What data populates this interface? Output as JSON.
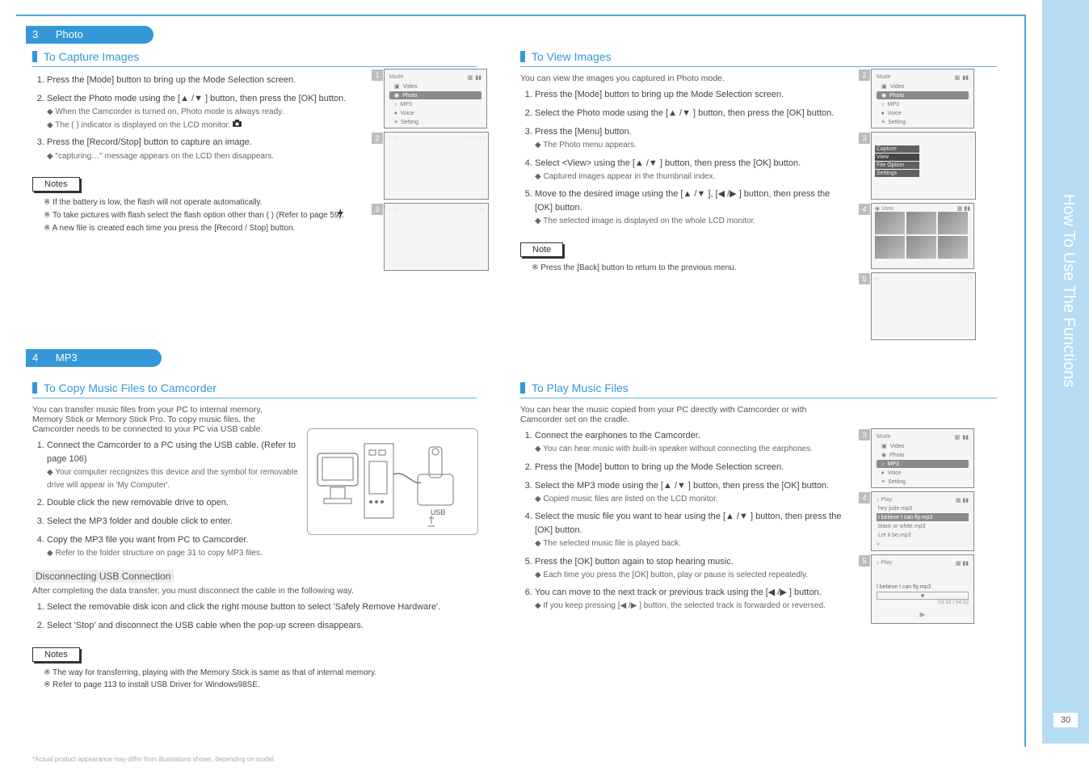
{
  "page": {
    "side_label": "How To Use The Functions",
    "page_number": "30"
  },
  "chapter_photo": {
    "tab_num": "3",
    "tab_title": "Photo"
  },
  "chapter_mp3": {
    "tab_num": "4",
    "tab_title": "MP3"
  },
  "sections": {
    "capture": {
      "title": "To Capture Images",
      "steps": [
        "Press the [Mode] button to bring up the Mode Selection screen.",
        "Select the Photo mode using the [▲ /▼ ] button, then press the [OK] button.",
        "◆ When the Camcorder is turned on, Photo mode is always ready.",
        "◆ The ( ) indicator is displayed on the LCD monitor.",
        "Press the [Record/Stop] button to capture an image.",
        "◆ \"capturing…\" message appears on the LCD then disappears."
      ],
      "notes_label": "Notes",
      "notes": [
        "If the battery is low, the flash will not operate automatically.",
        "To take pictures with flash select the flash option other than ( ) (Refer to page 59).",
        "A new file is created each time you press the [Record / Stop] button."
      ]
    },
    "view": {
      "title": "To View Images",
      "intro": "You can view the images you captured in Photo mode.",
      "steps": [
        "Press the [Mode] button to bring up the Mode Selection screen.",
        "Select the Photo mode using the [▲ /▼ ] button, then press the [OK] button.",
        "Press the [Menu] button.",
        "◆ The Photo menu appears.",
        "Select <View> using the [▲ /▼ ] button, then press the [OK] button.",
        "◆ Captured images appear in the thumbnail index.",
        "Move to the desired image using the [▲ /▼ ], [◀ /▶ ] button, then press the [OK] button.",
        "◆ The selected image is displayed on the whole LCD monitor."
      ],
      "notes_label": "Note",
      "notes": [
        "Press the [Back] button to return to the previous menu."
      ]
    },
    "copy": {
      "title": "To Copy Music Files to Camcorder",
      "intro": "You can transfer music files from your PC to internal memory, Memory Stick or Memory Stick Pro. To copy music files, the Camcorder needs to be connected to your PC via USB cable.",
      "steps": [
        "Connect the Camcorder to a PC using the USB cable. (Refer to page 106)",
        "◆ Your computer recognizes this device and the symbol for removable drive will appear in 'My Computer'.",
        "Double click the new removable drive to open.",
        "Select the MP3 folder and double click to enter.",
        "Copy the MP3 file you want from PC to Camcorder.",
        "◆ Refer to the folder structure on page 31 to copy MP3 files."
      ],
      "disconnect_title": "Disconnecting USB Connection",
      "disconnect_text": "After completing the data transfer, you must disconnect the cable in the following way.",
      "disconnect_steps": [
        "Select the removable disk icon and click the right mouse button to select 'Safely Remove Hardware'.",
        "Select 'Stop' and disconnect the USB cable when the pop-up screen disappears."
      ],
      "notes_label": "Notes",
      "notes": [
        "The way for transferring, playing with the Memory Stick is same as that of internal memory.",
        "Refer to page 113 to install USB Driver for Windows98SE."
      ]
    },
    "play": {
      "title": "To Play Music Files",
      "intro": "You can hear the music copied from your PC directly with Camcorder or with Camcorder set on the cradle.",
      "steps": [
        "Connect the earphones to the Camcorder.",
        "◆ You can hear music with built-in speaker without connecting the earphones.",
        "Press the [Mode] button to bring up the Mode Selection screen.",
        "Select the MP3 mode using the [▲ /▼ ] button, then press the [OK] button.",
        "◆ Copied music files are listed on the LCD monitor.",
        "Select the music file you want to hear using the [▲ /▼ ] button, then press the [OK] button.",
        "◆ The selected music file is played back.",
        "Press the [OK] button again to stop hearing music.",
        "◆ Each time you press the [OK] button, play or pause is selected repeatedly.",
        "You can move to the next track or previous track using the [◀ /▶ ] button.",
        "◆ If you keep pressing [◀ /▶ ] button, the selected track is forwarded or reversed."
      ]
    }
  },
  "shots": {
    "menu1": {
      "num": "1",
      "header_left": "Mode",
      "rows": [
        "Video",
        "Photo",
        "MP3",
        "Voice",
        "Setting"
      ]
    },
    "menu2": {
      "num": "2",
      "header_left": "Mode",
      "rows": [
        "Video",
        "Photo",
        "MP3",
        "Voice",
        "Setting"
      ]
    },
    "cap_preview": {
      "num": "2",
      "top_right": "Capture"
    },
    "cap_done": {
      "num": "3"
    },
    "view_menu": {
      "num": "3",
      "items": [
        "Capture",
        "View",
        "File Option",
        "Settings"
      ]
    },
    "thumbs": {
      "num": "4",
      "top_left": "View"
    },
    "full": {
      "num": "5"
    },
    "mp3_menu": {
      "num": "3",
      "header_left": "Mode",
      "rows": [
        "Video",
        "Photo",
        "MP3",
        "Voice",
        "Setting"
      ]
    },
    "mp3_list": {
      "num": "4",
      "header": "Play",
      "rows": [
        "hey jude.mp3",
        "I believe I can fly.mp3",
        "black or white.mp3",
        "Let it be.mp3"
      ]
    },
    "mp3_play": {
      "num": "5",
      "header": "Play",
      "track": "I believe I can fly.mp3",
      "time": "03:19 / 04:32"
    }
  },
  "footer_note": "*Actual product appearance may differ from illustrations shown, depending on model."
}
